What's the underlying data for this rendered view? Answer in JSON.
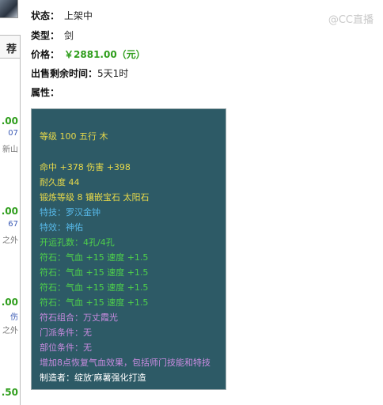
{
  "sidebar": {
    "header": "荐",
    "prices": [
      ".00",
      ".00",
      ".00",
      ".50"
    ],
    "snippets": [
      "07",
      "新山",
      "67",
      "之外",
      "伤",
      "之外"
    ]
  },
  "info": {
    "status_label": "状态：",
    "status_value": "上架中",
    "type_label": "类型：",
    "type_value": "剑",
    "price_label": "价格：",
    "price_value": "￥2881.00（元）",
    "remaining_label": "出售剩余时间：",
    "remaining_value": "5天1时",
    "attr_label": "属性："
  },
  "watermark": "@CC直播",
  "item": {
    "lines": [
      "等级 100 五行 木",
      "命中 +378 伤害 +398",
      "耐久度 44",
      "锻炼等级 8 镶嵌宝石 太阳石",
      "特技：罗汉金钟",
      "特效：神佑",
      "开运孔数：4孔/4孔",
      "符石：气血 +15 速度 +1.5",
      "符石：气血 +15 速度 +1.5",
      "符石：气血 +15 速度 +1.5",
      "符石：气血 +15 速度 +1.5",
      "符石组合：万丈霞光",
      "门派条件：无",
      "部位条件：无",
      "增加8点恢复气血效果，包括师门技能和特技",
      "制造者：绽放′麻薯强化打造"
    ]
  },
  "colors": {
    "panel_bg": "#2d5a66",
    "price_green": "#2e9d1b",
    "yellow": "#e8d94a",
    "blue": "#57b8e8",
    "green": "#4fd14a",
    "purple": "#c98be0"
  }
}
